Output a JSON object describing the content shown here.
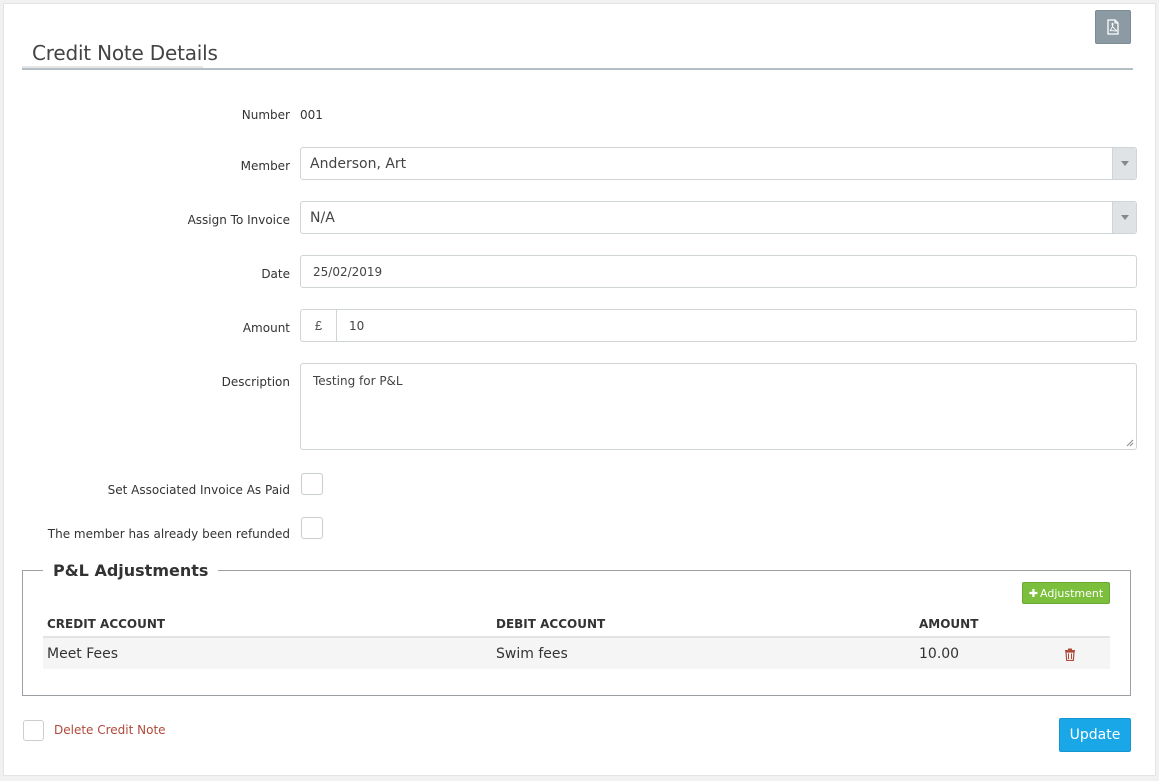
{
  "header": {
    "title": "Credit Note Details",
    "pdf_icon": "pdf-file-icon"
  },
  "form": {
    "number": {
      "label": "Number",
      "value": "001"
    },
    "member": {
      "label": "Member",
      "value": "Anderson, Art"
    },
    "assign_invoice": {
      "label": "Assign To Invoice",
      "value": "N/A"
    },
    "date": {
      "label": "Date",
      "value": "25/02/2019"
    },
    "amount": {
      "label": "Amount",
      "currency": "£",
      "value": "10"
    },
    "description": {
      "label": "Description",
      "value": "Testing for P&L"
    },
    "set_paid": {
      "label": "Set Associated Invoice As Paid",
      "checked": false
    },
    "refunded": {
      "label": "The member has already been refunded",
      "checked": false
    }
  },
  "pl_adjustments": {
    "legend": "P&L Adjustments",
    "add_button": "Adjustment",
    "columns": [
      "CREDIT ACCOUNT",
      "DEBIT ACCOUNT",
      "AMOUNT"
    ],
    "rows": [
      {
        "credit": "Meet Fees",
        "debit": "Swim fees",
        "amount": "10.00"
      }
    ]
  },
  "footer": {
    "delete_label": "Delete Credit Note",
    "update_label": "Update"
  },
  "colors": {
    "accent_blue": "#1aa7e8",
    "accent_green": "#7cbf3c",
    "danger": "#b04a3a",
    "pdf_button": "#8c9aa3"
  }
}
